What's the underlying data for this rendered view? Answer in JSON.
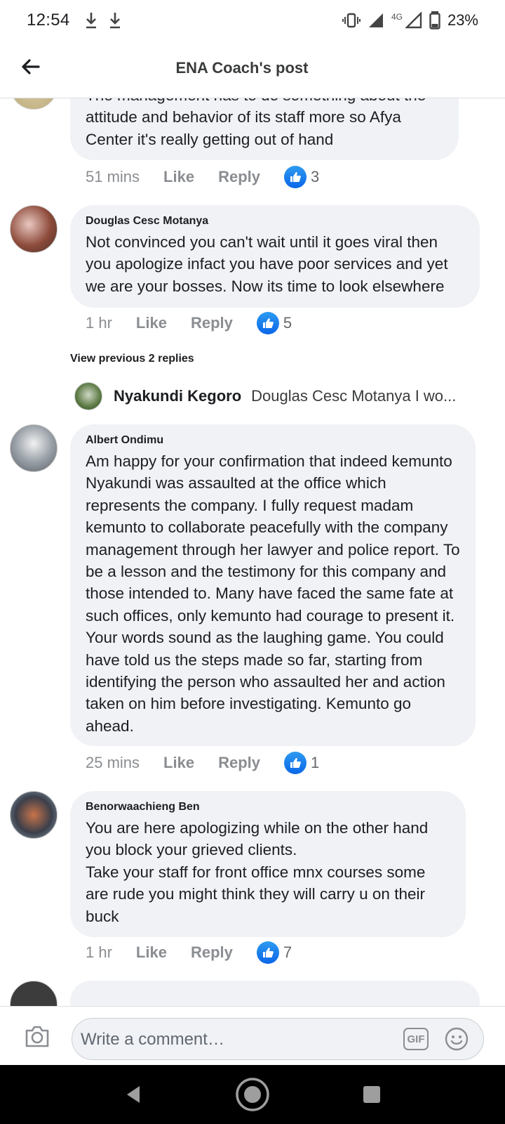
{
  "status_bar": {
    "time": "12:54",
    "network": "4G",
    "battery": "23%"
  },
  "header": {
    "title": "ENA Coach's post"
  },
  "comments": [
    {
      "author": "",
      "text": "The management has to do something about the attitude and behavior of its staff more so Afya Center it's really getting out of hand",
      "time": "51 mins",
      "like_label": "Like",
      "reply_label": "Reply",
      "reactions": "3"
    },
    {
      "author": "Douglas Cesc Motanya",
      "text": "Not convinced you can't wait until it goes viral then you apologize infact you have poor services and yet we are your bosses. Now its time to look elsewhere",
      "time": "1 hr",
      "like_label": "Like",
      "reply_label": "Reply",
      "reactions": "5"
    },
    {
      "author": "Albert Ondimu",
      "text": "Am happy for your confirmation that indeed kemunto Nyakundi was assaulted at the office which represents the company. I fully request madam kemunto to collaborate peacefully with the company management through her lawyer and police report. To be a lesson and the testimony for this company and those intended to. Many have faced the same fate at such offices, only kemunto had courage to present it. Your words sound as the laughing game. You could have told us the steps made so far, starting from identifying the person who assaulted her and action taken on him before investigating. Kemunto go ahead.",
      "time": "25 mins",
      "like_label": "Like",
      "reply_label": "Reply",
      "reactions": "1"
    },
    {
      "author": "Benorwaachieng Ben",
      "text": "You are here apologizing while on the other hand you block your grieved clients.\nTake your staff for front office mnx courses some are rude you might think they will carry u on their buck",
      "time": "1 hr",
      "like_label": "Like",
      "reply_label": "Reply",
      "reactions": "7"
    }
  ],
  "view_previous_replies": "View previous 2 replies",
  "reply_preview": {
    "author": "Nyakundi Kegoro",
    "text": "Douglas Cesc Motanya I wo..."
  },
  "composer": {
    "placeholder": "Write a comment…",
    "gif_label": "GIF"
  }
}
